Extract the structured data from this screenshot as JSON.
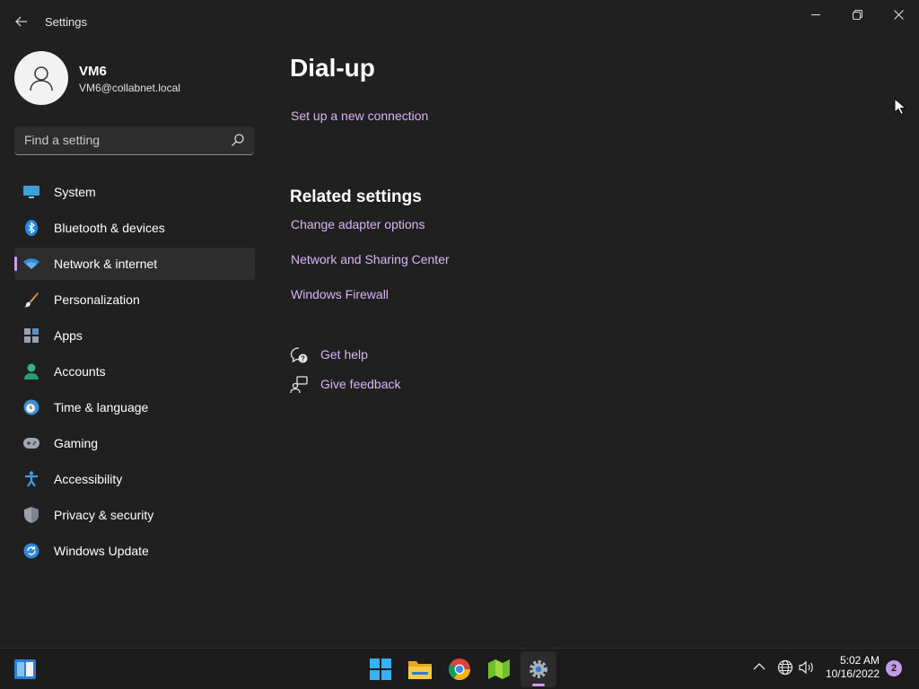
{
  "window": {
    "title": "Settings"
  },
  "profile": {
    "name": "VM6",
    "email": "VM6@collabnet.local"
  },
  "search": {
    "placeholder": "Find a setting"
  },
  "nav": {
    "items": [
      {
        "label": "System",
        "icon": "monitor-icon"
      },
      {
        "label": "Bluetooth & devices",
        "icon": "bluetooth-icon"
      },
      {
        "label": "Network & internet",
        "icon": "wifi-icon",
        "active": true
      },
      {
        "label": "Personalization",
        "icon": "brush-icon"
      },
      {
        "label": "Apps",
        "icon": "apps-icon"
      },
      {
        "label": "Accounts",
        "icon": "person-icon"
      },
      {
        "label": "Time & language",
        "icon": "clock-globe-icon"
      },
      {
        "label": "Gaming",
        "icon": "gamepad-icon"
      },
      {
        "label": "Accessibility",
        "icon": "accessibility-icon"
      },
      {
        "label": "Privacy & security",
        "icon": "shield-icon"
      },
      {
        "label": "Windows Update",
        "icon": "update-icon"
      }
    ]
  },
  "main": {
    "title": "Dial-up",
    "setup_link": "Set up a new connection",
    "related": {
      "heading": "Related settings",
      "links": [
        "Change adapter options",
        "Network and Sharing Center",
        "Windows Firewall"
      ]
    },
    "help": {
      "get_help": "Get help",
      "give_feedback": "Give feedback"
    }
  },
  "taskbar": {
    "apps": [
      "widgets-icon",
      "start-icon",
      "file-explorer-icon",
      "chrome-icon",
      "app-icon",
      "settings-icon"
    ],
    "time": "5:02 AM",
    "date": "10/16/2022",
    "notifications": "2"
  },
  "colors": {
    "accent": "#d49cf1",
    "link": "#d8b4f5",
    "background": "#202020"
  }
}
